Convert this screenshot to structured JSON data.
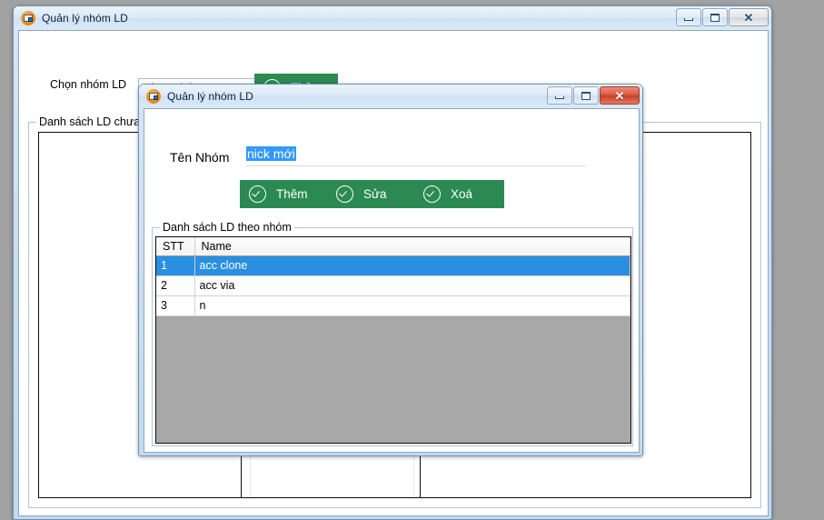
{
  "desktop": {
    "background_color": "#a2a2a2"
  },
  "main_window": {
    "title": "Quản lý nhóm LD",
    "icon": "app-icon",
    "caption": {
      "minimize": "minimize-icon",
      "maximize": "maximize-icon",
      "close": "✕",
      "close_active": false
    },
    "select_group": {
      "label": "Chọn nhóm LD",
      "combo_value": "Chọn nhóm LD",
      "combo_placeholder": "Chọn nhóm LD"
    },
    "add_button": {
      "label": "Thêm",
      "icon": "check-circle-icon",
      "color": "#2a8a52"
    },
    "list_groupbox": {
      "title": "Danh sách LD chưa thuộc"
    }
  },
  "dialog": {
    "title": "Quản lý nhóm LD",
    "icon": "app-icon",
    "caption": {
      "minimize": "minimize-icon",
      "maximize": "maximize-icon",
      "close": "✕",
      "close_active": true
    },
    "name_field": {
      "label": "Tên Nhóm",
      "value": "nick mới",
      "selected": true,
      "selection_color": "#3399ff"
    },
    "buttons": [
      {
        "label": "Thêm",
        "icon": "check-circle-icon",
        "color": "#2a8a52"
      },
      {
        "label": "Sửa",
        "icon": "check-circle-icon",
        "color": "#2a8a52"
      },
      {
        "label": "Xoá",
        "icon": "check-circle-icon",
        "color": "#2a8a52"
      }
    ],
    "groupbox": {
      "title": "Danh sách LD theo nhóm"
    },
    "grid": {
      "columns": [
        "STT",
        "Name"
      ],
      "rows": [
        {
          "stt": "1",
          "name": "acc clone",
          "selected": true
        },
        {
          "stt": "2",
          "name": "acc via",
          "selected": false
        },
        {
          "stt": "3",
          "name": "n",
          "selected": false
        }
      ],
      "empty_area_color": "#a8a8a8",
      "selection_color": "#2a8fe0"
    }
  }
}
